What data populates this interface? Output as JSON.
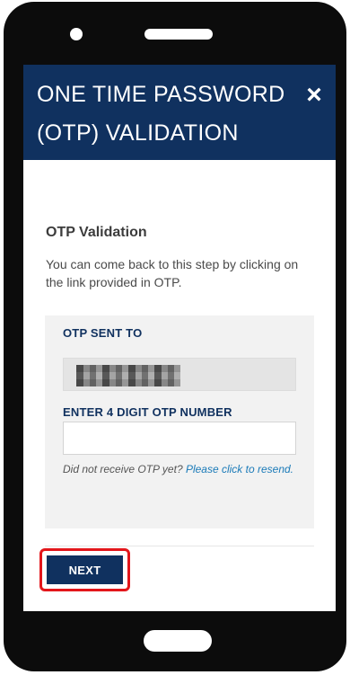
{
  "modal": {
    "title_line1": "ONE TIME PASSWORD",
    "title_line2": "(OTP) VALIDATION",
    "close_label": "×"
  },
  "section": {
    "title": "OTP Validation",
    "description": "You can come back to this step by clicking on the link provided in OTP."
  },
  "otp": {
    "sent_to_label": "OTP SENT TO",
    "sent_to_value": "",
    "enter_label": "ENTER 4 DIGIT OTP NUMBER",
    "input_value": "",
    "resend_prefix": "Did not receive OTP yet? ",
    "resend_link": "Please click to resend."
  },
  "actions": {
    "next_label": "NEXT"
  },
  "colors": {
    "header_bg": "#10315f",
    "link": "#1a7ab8",
    "highlight": "#e3161b"
  }
}
